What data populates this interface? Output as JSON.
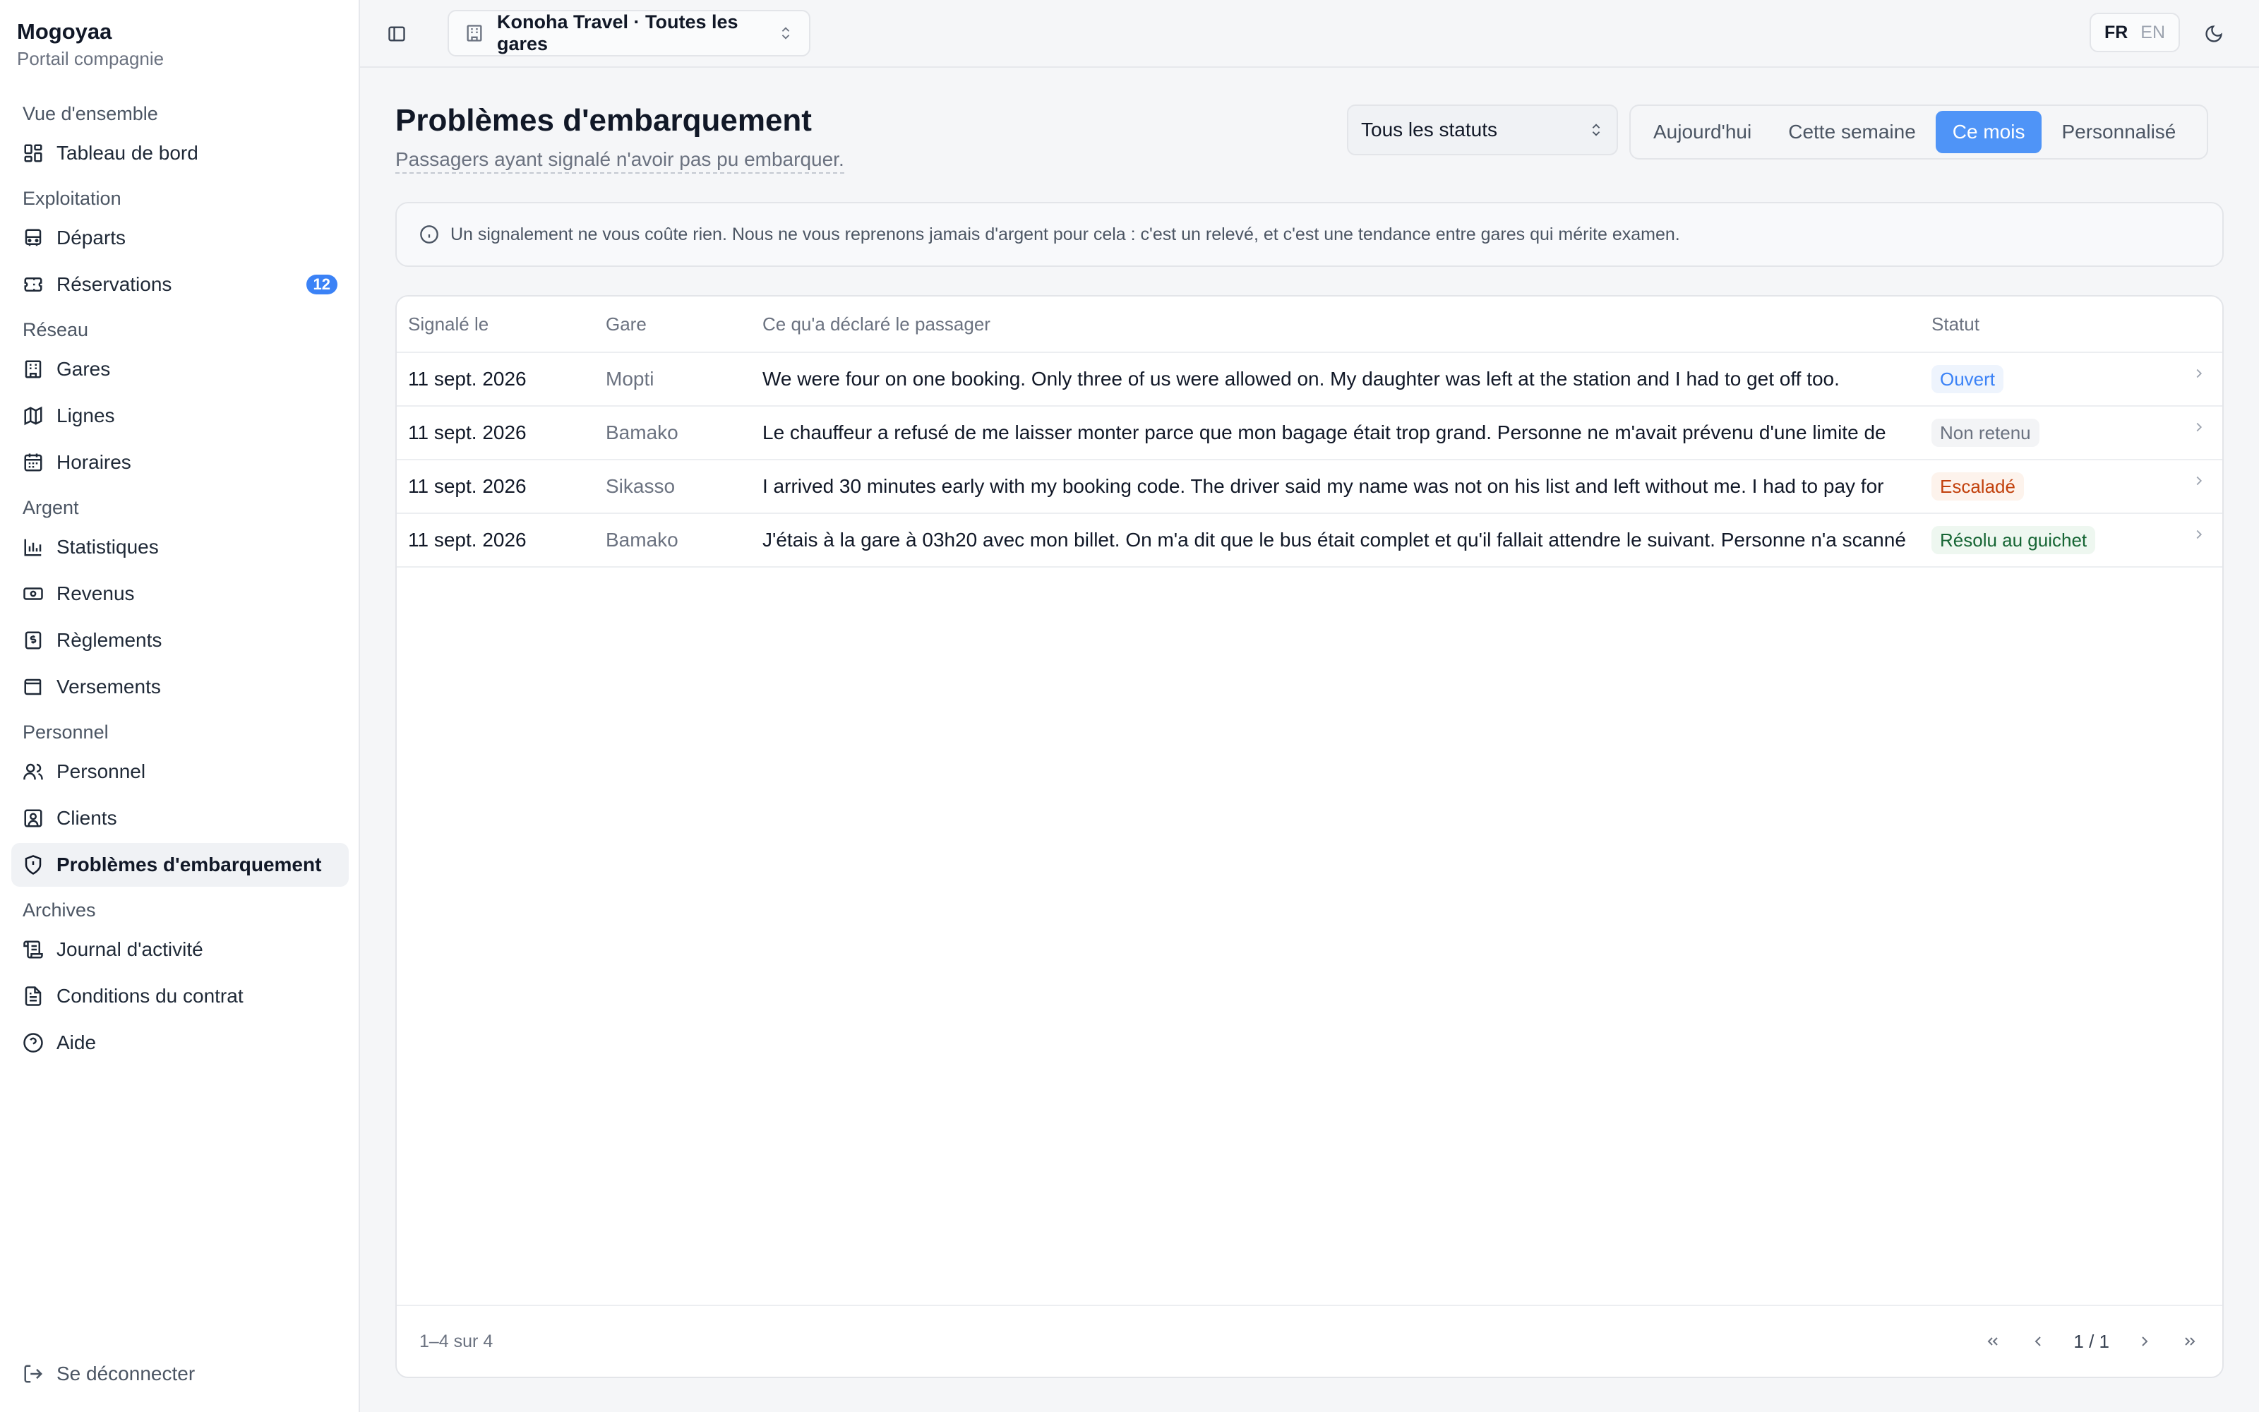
{
  "brand": {
    "name": "Mogoyaa",
    "subtitle": "Portail compagnie"
  },
  "sidebar": {
    "groups": [
      {
        "label": "Vue d'ensemble",
        "items": [
          {
            "label": "Tableau de bord",
            "icon": "dashboard-icon"
          }
        ]
      },
      {
        "label": "Exploitation",
        "items": [
          {
            "label": "Départs",
            "icon": "bus-icon"
          },
          {
            "label": "Réservations",
            "icon": "ticket-icon",
            "badge": "12"
          }
        ]
      },
      {
        "label": "Réseau",
        "items": [
          {
            "label": "Gares",
            "icon": "building-icon"
          },
          {
            "label": "Lignes",
            "icon": "map-icon"
          },
          {
            "label": "Horaires",
            "icon": "calendar-icon"
          }
        ]
      },
      {
        "label": "Argent",
        "items": [
          {
            "label": "Statistiques",
            "icon": "bar-chart-icon"
          },
          {
            "label": "Revenus",
            "icon": "banknote-icon"
          },
          {
            "label": "Règlements",
            "icon": "receipt-icon"
          },
          {
            "label": "Versements",
            "icon": "wallet-icon"
          }
        ]
      },
      {
        "label": "Personnel",
        "items": [
          {
            "label": "Personnel",
            "icon": "users-icon"
          },
          {
            "label": "Clients",
            "icon": "contact-icon"
          },
          {
            "label": "Problèmes d'embarquement",
            "icon": "shield-alert-icon",
            "active": true
          }
        ]
      },
      {
        "label": "Archives",
        "items": [
          {
            "label": "Journal d'activité",
            "icon": "scroll-icon"
          },
          {
            "label": "Conditions du contrat",
            "icon": "document-icon"
          },
          {
            "label": "Aide",
            "icon": "help-circle-icon"
          }
        ]
      }
    ],
    "logout_label": "Se déconnecter"
  },
  "topbar": {
    "company_selector": "Konoha Travel · Toutes les gares",
    "lang_fr": "FR",
    "lang_en": "EN"
  },
  "page": {
    "title": "Problèmes d'embarquement",
    "subtitle": "Passagers ayant signalé n'avoir pas pu embarquer."
  },
  "filters": {
    "status_value": "Tous les statuts",
    "periods": [
      {
        "label": "Aujourd'hui"
      },
      {
        "label": "Cette semaine"
      },
      {
        "label": "Ce mois",
        "active": true
      },
      {
        "label": "Personnalisé"
      }
    ]
  },
  "notice": "Un signalement ne vous coûte rien. Nous ne vous reprenons jamais d'argent pour cela : c'est un relevé, et c'est une tendance entre gares qui mérite examen.",
  "table": {
    "columns": {
      "date": "Signalé le",
      "station": "Gare",
      "statement": "Ce qu'a déclaré le passager",
      "status": "Statut"
    },
    "rows": [
      {
        "date": "11 sept. 2026",
        "station": "Mopti",
        "statement": "We were four on one booking. Only three of us were allowed on. My daughter was left at the station and I had to get off too.",
        "status": "Ouvert",
        "status_kind": "open"
      },
      {
        "date": "11 sept. 2026",
        "station": "Bamako",
        "statement": "Le chauffeur a refusé de me laisser monter parce que mon bagage était trop grand. Personne ne m'avait prévenu d'une limite de",
        "status": "Non retenu",
        "status_kind": "rejected"
      },
      {
        "date": "11 sept. 2026",
        "station": "Sikasso",
        "statement": "I arrived 30 minutes early with my booking code. The driver said my name was not on his list and left without me. I had to pay for",
        "status": "Escaladé",
        "status_kind": "escalated"
      },
      {
        "date": "11 sept. 2026",
        "station": "Bamako",
        "statement": "J'étais à la gare à 03h20 avec mon billet. On m'a dit que le bus était complet et qu'il fallait attendre le suivant. Personne n'a scanné",
        "status": "Résolu au guichet",
        "status_kind": "resolved"
      }
    ],
    "count_text": "1–4 sur 4",
    "page_text": "1 / 1"
  }
}
